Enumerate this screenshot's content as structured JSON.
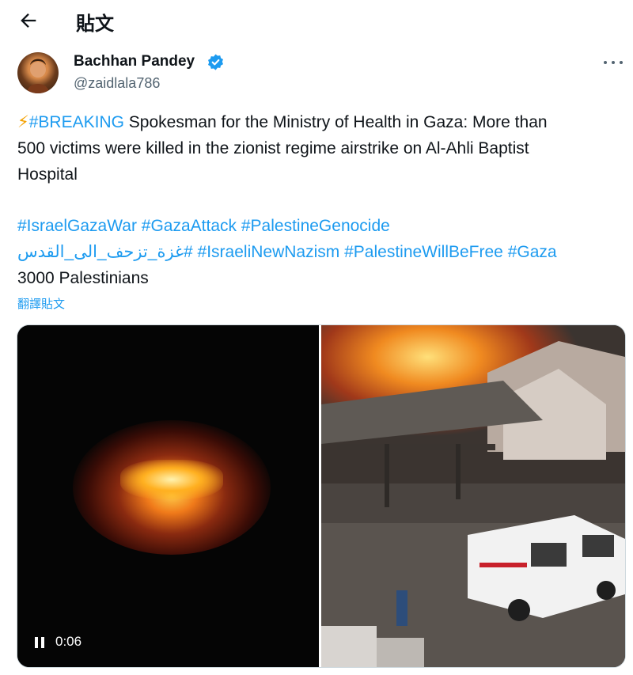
{
  "header": {
    "title": "貼文"
  },
  "author": {
    "name": "Bachhan Pandey",
    "handle": "@zaidlala786",
    "verified_color": "#1d9bf0"
  },
  "tweet": {
    "line1": {
      "emoji": "⚡",
      "hashtag": "#BREAKING",
      "text": " Spokesman for the Ministry of Health in Gaza: More than"
    },
    "line2": "500 victims were killed in the zionist regime airstrike on Al-Ahli Baptist",
    "line3": "Hospital",
    "hashtags_line1": [
      "#IsraelGazaWar",
      "#GazaAttack",
      "#PalestineGenocide"
    ],
    "hashtags_line2": [
      "#غزة_تزحف_الى_القدس",
      "#IsraeliNewNazism",
      "#PalestineWillBeFree",
      "#Gaza"
    ],
    "line_last": "3000 Palestinians",
    "translate_link": "翻譯貼文"
  },
  "media": {
    "video_timestamp": "0:06"
  },
  "colors": {
    "link": "#1d9bf0",
    "text": "#0f1419",
    "secondary": "#536471",
    "border": "#cfd9de"
  }
}
